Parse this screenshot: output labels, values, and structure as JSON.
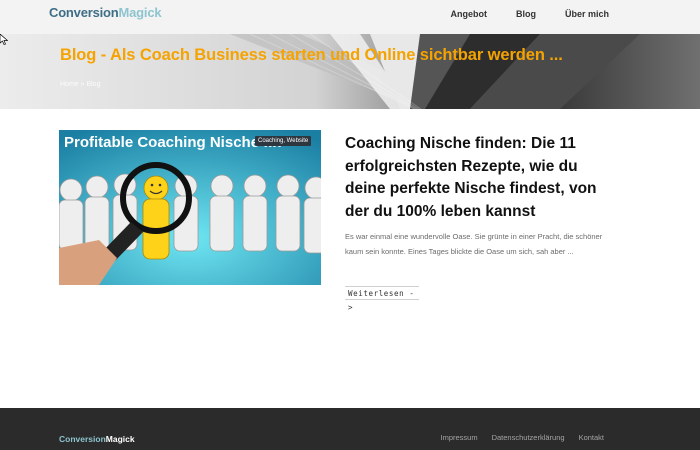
{
  "header": {
    "logo_part1": "Conversion",
    "logo_part2": "Magick",
    "nav": [
      "Angebot",
      "Blog",
      "Über mich"
    ]
  },
  "hero": {
    "title": "Blog - Als Coach Business starten und Online sichtbar werden ...",
    "breadcrumb": "Home » Blog"
  },
  "post": {
    "thumbnail_text": "Profitable Coaching Nische fin",
    "category": "Coaching, Website",
    "title": "Coaching Nische finden: Die 11 erfolgreichsten Rezepte, wie du deine perfekte Nische findest, von der du 100% leben kannst",
    "excerpt": "Es war einmal eine wundervolle Oase. Sie grünte in einer Pracht, die schöner kaum sein konnte. Eines Tages blickte die Oase um sich, sah aber ...",
    "read_more": "Weiterlesen ->"
  },
  "footer": {
    "logo_part1": "Conversion",
    "logo_part2": "Magick",
    "links": [
      "Impressum",
      "Datenschutzerklärung",
      "Kontakt"
    ]
  },
  "colors": {
    "hero_title": "#f5a300",
    "logo_dark": "#3d6e86",
    "logo_light": "#8ec4cf",
    "footer_bg": "#2b2b2b"
  }
}
